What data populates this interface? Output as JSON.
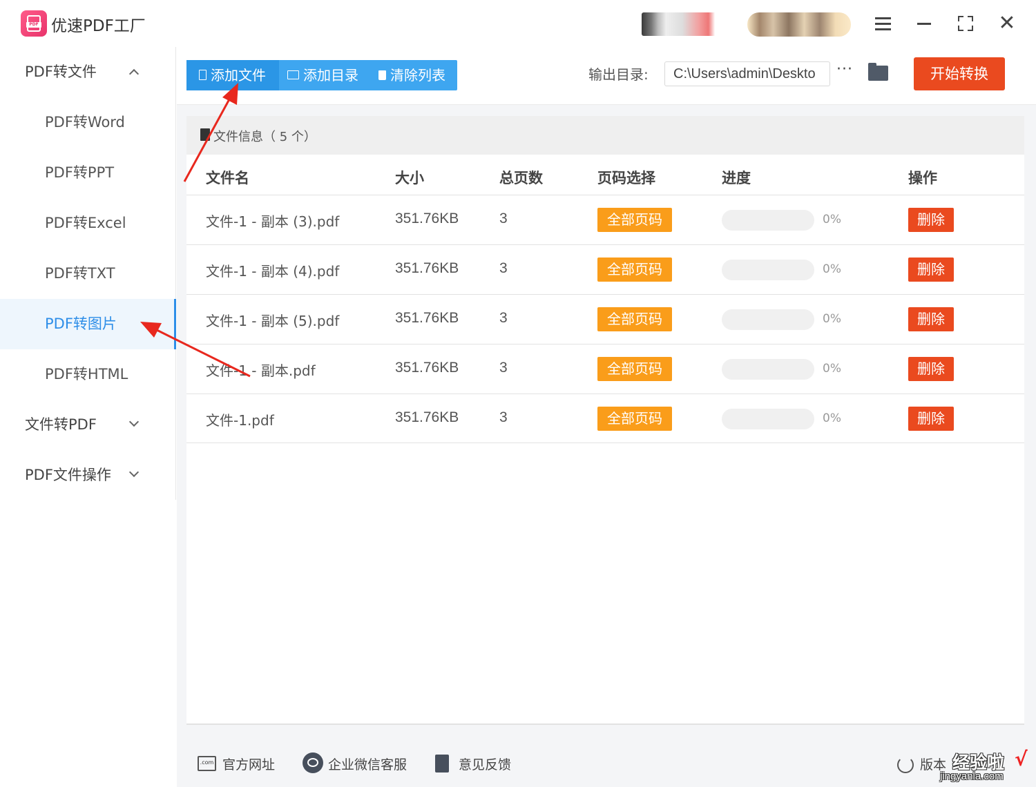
{
  "app": {
    "title": "优速PDF工厂",
    "logo_text": "PDF"
  },
  "window": {
    "menu_icon": "hamburger-icon",
    "min_icon": "minimize-icon",
    "max_icon": "fullscreen-icon",
    "close_icon": "close-icon",
    "close_glyph": "✕"
  },
  "sidebar": {
    "groups": [
      {
        "label": "PDF转文件",
        "expanded": true
      },
      {
        "label": "文件转PDF",
        "expanded": false
      },
      {
        "label": "PDF文件操作",
        "expanded": false
      }
    ],
    "items": [
      {
        "label": "PDF转Word"
      },
      {
        "label": "PDF转PPT"
      },
      {
        "label": "PDF转Excel"
      },
      {
        "label": "PDF转TXT"
      },
      {
        "label": "PDF转图片",
        "active": true
      },
      {
        "label": "PDF转HTML"
      }
    ]
  },
  "toolbar": {
    "add_file": "添加文件",
    "add_dir": "添加目录",
    "clear_list": "清除列表",
    "output_label": "输出目录:",
    "output_path": "C:\\Users\\admin\\Deskto",
    "more": "···",
    "start": "开始转换"
  },
  "panel": {
    "title": "文件信息（ 5 个）",
    "columns": {
      "name": "文件名",
      "size": "大小",
      "pages": "总页数",
      "page_select": "页码选择",
      "progress": "进度",
      "action": "操作"
    },
    "rows": [
      {
        "name": "文件-1 - 副本 (3).pdf",
        "size": "351.76KB",
        "pages": "3",
        "page_select": "全部页码",
        "progress": 0,
        "progress_text": "0%",
        "action": "删除"
      },
      {
        "name": "文件-1 - 副本 (4).pdf",
        "size": "351.76KB",
        "pages": "3",
        "page_select": "全部页码",
        "progress": 0,
        "progress_text": "0%",
        "action": "删除"
      },
      {
        "name": "文件-1 - 副本 (5).pdf",
        "size": "351.76KB",
        "pages": "3",
        "page_select": "全部页码",
        "progress": 0,
        "progress_text": "0%",
        "action": "删除"
      },
      {
        "name": "文件-1 - 副本.pdf",
        "size": "351.76KB",
        "pages": "3",
        "page_select": "全部页码",
        "progress": 0,
        "progress_text": "0%",
        "action": "删除"
      },
      {
        "name": "文件-1.pdf",
        "size": "351.76KB",
        "pages": "3",
        "page_select": "全部页码",
        "progress": 0,
        "progress_text": "0%",
        "action": "删除"
      }
    ]
  },
  "footer": {
    "website": "官方网址",
    "wechat": "企业微信客服",
    "feedback": "意见反馈",
    "version": "版本",
    "com_icon_text": ".com"
  },
  "watermark": {
    "main": "经验啦",
    "sub": "jingyanla.com",
    "check": "√"
  },
  "colors": {
    "accent": "#2e8ee8",
    "toolbar_blue": "#3ea6f0",
    "start_red": "#ea4a1f",
    "page_orange": "#fa9d1a",
    "arrow_red": "#e8281e"
  }
}
